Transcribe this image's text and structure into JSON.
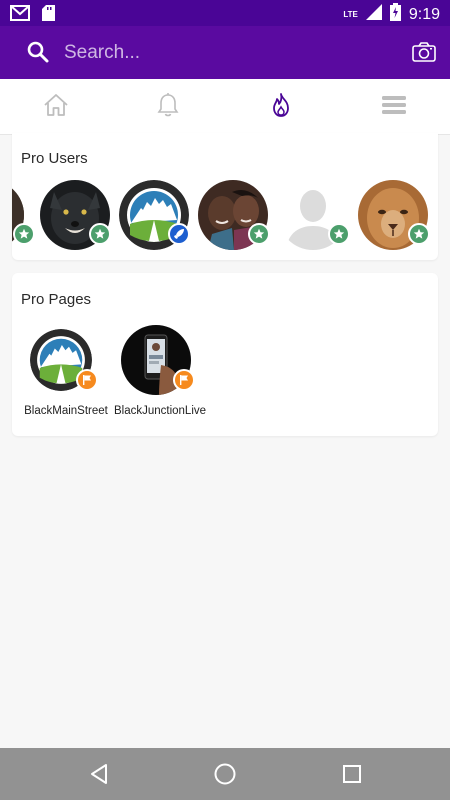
{
  "status_bar": {
    "time": "9:19",
    "network": "LTE",
    "icons": [
      "gmail-icon",
      "sd-card-icon",
      "signal-icon",
      "battery-charging-icon"
    ]
  },
  "search": {
    "placeholder": "Search...",
    "icon": "search-icon",
    "camera_icon": "camera-icon"
  },
  "tabs": [
    {
      "name": "home",
      "icon": "home-icon",
      "active": false
    },
    {
      "name": "notifications",
      "icon": "bell-icon",
      "active": false
    },
    {
      "name": "trending",
      "icon": "flame-icon",
      "active": true
    },
    {
      "name": "menu",
      "icon": "menu-icon",
      "active": false
    }
  ],
  "pro_users": {
    "title": "Pro Users",
    "users": [
      {
        "avatar": "partial-avatar",
        "badge": "star"
      },
      {
        "avatar": "wolf",
        "badge": "star"
      },
      {
        "avatar": "black-main-street-logo",
        "badge": "rocket"
      },
      {
        "avatar": "couple-photo",
        "badge": "star"
      },
      {
        "avatar": "default-silhouette",
        "badge": "star"
      },
      {
        "avatar": "lion",
        "badge": "star"
      }
    ]
  },
  "pro_pages": {
    "title": "Pro Pages",
    "pages": [
      {
        "name": "BlackMainStreet",
        "avatar": "black-main-street-logo",
        "badge": "flag"
      },
      {
        "name": "BlackJunctionLive",
        "avatar": "phone-live-photo",
        "badge": "flag"
      }
    ]
  },
  "nav": {
    "buttons": [
      "back-icon",
      "home-circle-icon",
      "recents-square-icon"
    ]
  },
  "colors": {
    "status_bar": "#4a0596",
    "header": "#5a0aa0",
    "accent": "#4a0596",
    "badge_green": "#4c9f6c",
    "badge_blue": "#1d5fd0",
    "badge_orange": "#f68a1e",
    "nav_bar": "#929292"
  }
}
